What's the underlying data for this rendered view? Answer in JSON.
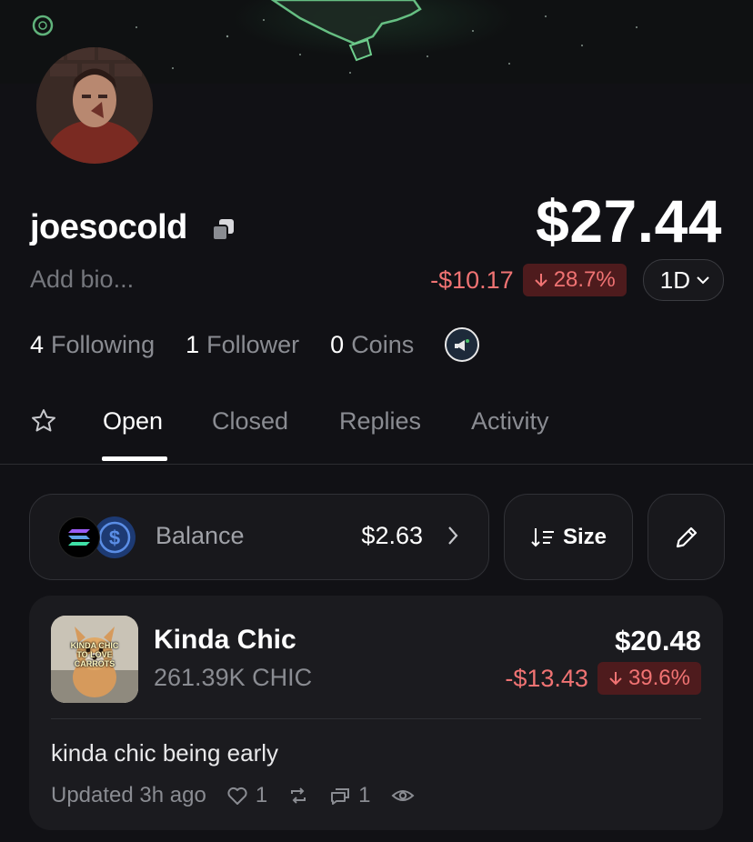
{
  "profile": {
    "username": "joesocold",
    "bio_placeholder": "Add bio...",
    "avatar": "avatar-photo"
  },
  "portfolio": {
    "total_value": "$27.44",
    "change_amount": "-$10.17",
    "change_percent": "28.7%",
    "range": "1D"
  },
  "stats": {
    "following_count": "4",
    "following_label": "Following",
    "followers_count": "1",
    "followers_label": "Follower",
    "coins_count": "0",
    "coins_label": "Coins"
  },
  "tabs": [
    {
      "label": "Open",
      "active": true
    },
    {
      "label": "Closed"
    },
    {
      "label": "Replies"
    },
    {
      "label": "Activity"
    }
  ],
  "balance": {
    "label": "Balance",
    "value": "$2.63"
  },
  "sort": {
    "label": "Size"
  },
  "position": {
    "name": "Kinda Chic",
    "quantity": "261.39K CHIC",
    "value": "$20.48",
    "change_amount": "-$13.43",
    "change_percent": "39.6%",
    "image_text": "KINDA CHIC TO LOVE CARROTS",
    "caption": "kinda chic being early",
    "updated": "Updated 3h ago",
    "likes": "1",
    "comments": "1"
  },
  "colors": {
    "background": "#111115",
    "negative": "#f07373",
    "negative_bg": "#4e1b1d"
  }
}
